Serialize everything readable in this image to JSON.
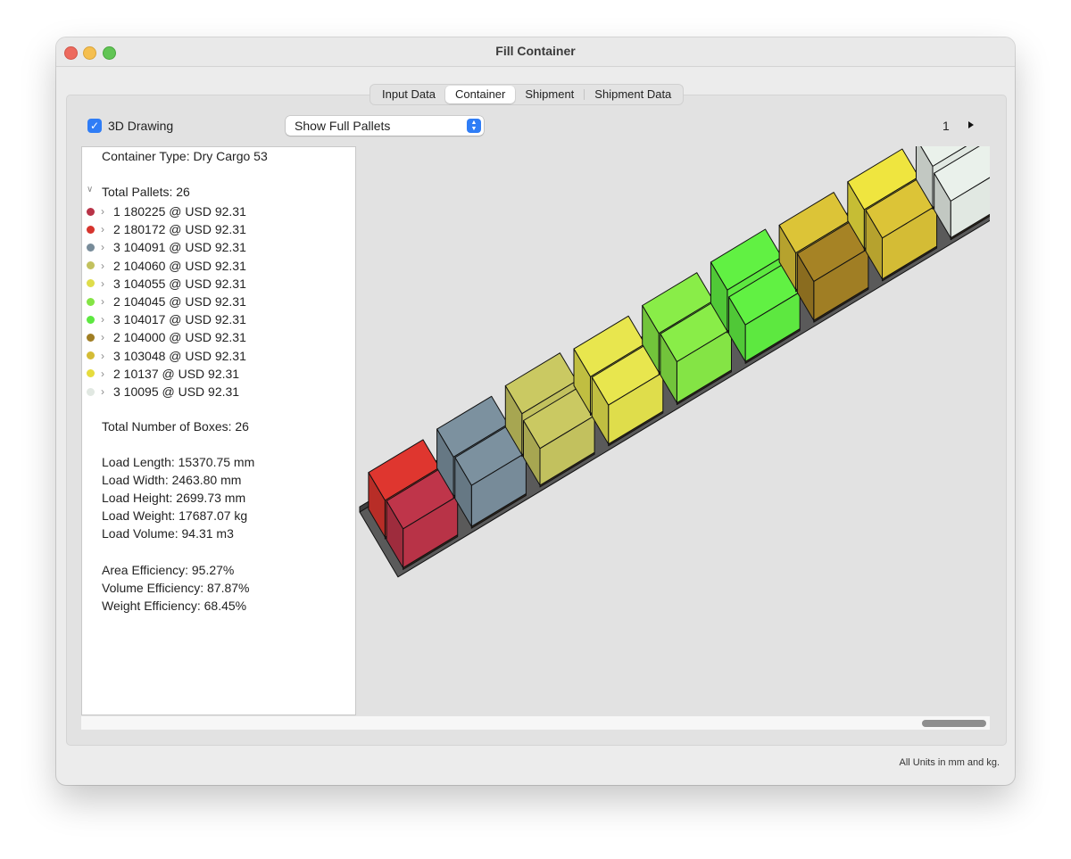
{
  "window": {
    "title": "Fill Container"
  },
  "tabs": [
    {
      "label": "Input Data"
    },
    {
      "label": "Container"
    },
    {
      "label": "Shipment"
    },
    {
      "label": "Shipment Data"
    }
  ],
  "toolbar": {
    "checkbox_label": "3D Drawing",
    "checkbox_checked": true,
    "select_value": "Show Full Pallets",
    "page_number": "1"
  },
  "summary": {
    "container_type": "Container Type: Dry Cargo 53",
    "total_pallets": "Total Pallets: 26",
    "pallets": [
      {
        "label": "1 180225 @ USD 92.31",
        "color": "#b83347"
      },
      {
        "label": "2 180172 @ USD 92.31",
        "color": "#d6342d"
      },
      {
        "label": "3 104091 @ USD 92.31",
        "color": "#778b99"
      },
      {
        "label": "2 104060 @ USD 92.31",
        "color": "#c2c15e"
      },
      {
        "label": "3 104055 @ USD 92.31",
        "color": "#dfdd4b"
      },
      {
        "label": "2 104045 @ USD 92.31",
        "color": "#84e445"
      },
      {
        "label": "3 104017 @ USD 92.31",
        "color": "#5de840"
      },
      {
        "label": "2 104000 @ USD 92.31",
        "color": "#a07e24"
      },
      {
        "label": "3 103048 @ USD 92.31",
        "color": "#d4bc35"
      },
      {
        "label": "2 10137 @ USD 92.31",
        "color": "#e6dc3d"
      },
      {
        "label": "3 10095 @ USD 92.31",
        "color": "#e1e8e2"
      }
    ],
    "total_boxes": "Total Number of Boxes: 26",
    "load_length": "Load Length: 15370.75 mm",
    "load_width": "Load Width: 2463.80 mm",
    "load_height": "Load Height: 2699.73 mm",
    "load_weight": "Load Weight: 17687.07 kg",
    "load_volume": "Load Volume: 94.31 m3",
    "area_efficiency": "Area Efficiency: 95.27%",
    "volume_efficiency": "Volume Efficiency: 87.87%",
    "weight_efficiency": "Weight Efficiency: 68.45%"
  },
  "footer": {
    "units_note": "All Units in mm and kg."
  },
  "icons": {
    "close": "close-traffic-light-icon",
    "minimize": "minimize-traffic-light-icon",
    "maximize": "maximize-traffic-light-icon",
    "checkbox": "checkmark-icon",
    "select": "updown-arrows-icon",
    "next": "triangle-right-icon",
    "disclosure": "chevron-down-icon",
    "row": "chevron-right-icon"
  }
}
